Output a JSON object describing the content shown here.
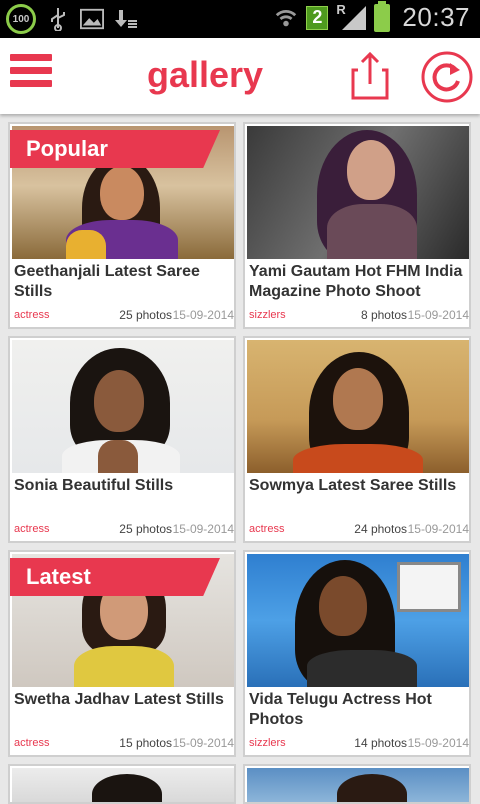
{
  "status_bar": {
    "battery_percent_badge": "100",
    "sim_slot": "2",
    "roaming_indicator": "R",
    "time": "20:37",
    "icons": [
      "battery-100-icon",
      "usb-icon",
      "image-icon",
      "download-icon",
      "wifi-icon",
      "signal-icon",
      "battery-charging-icon"
    ]
  },
  "app_bar": {
    "title": "gallery",
    "icons": [
      "menu-icon",
      "share-icon",
      "refresh-icon"
    ],
    "accent_color": "#e8384f"
  },
  "gallery": {
    "items": [
      {
        "title": "Geethanjali Latest Saree Stills",
        "category": "actress",
        "photos": "25 photos",
        "date": "15-09-2014",
        "ribbon": "Popular"
      },
      {
        "title": "Yami Gautam Hot FHM India Magazine Photo Shoot",
        "category": "sizzlers",
        "photos": "8 photos",
        "date": "15-09-2014",
        "ribbon": ""
      },
      {
        "title": "Sonia Beautiful Stills",
        "category": "actress",
        "photos": "25 photos",
        "date": "15-09-2014",
        "ribbon": ""
      },
      {
        "title": "Sowmya Latest Saree Stills",
        "category": "actress",
        "photos": "24 photos",
        "date": "15-09-2014",
        "ribbon": ""
      },
      {
        "title": "Swetha Jadhav Latest Stills",
        "category": "actress",
        "photos": "15 photos",
        "date": "15-09-2014",
        "ribbon": "Latest"
      },
      {
        "title": "Vida Telugu Actress Hot Photos",
        "category": "sizzlers",
        "photos": "14 photos",
        "date": "15-09-2014",
        "ribbon": ""
      }
    ]
  }
}
